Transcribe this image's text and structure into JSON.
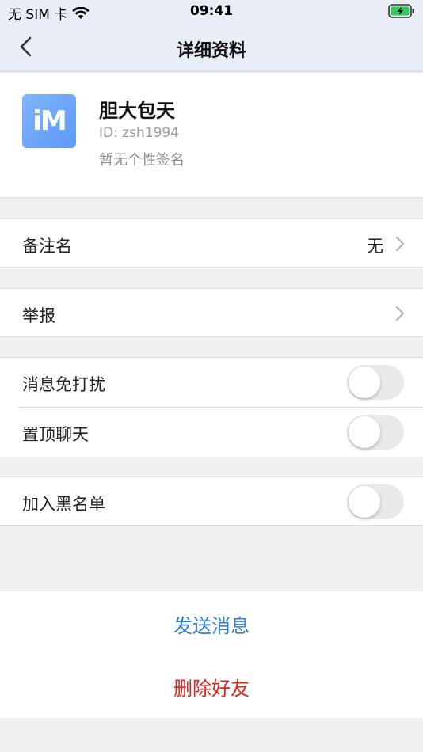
{
  "status_bar": {
    "carrier": "无 SIM 卡",
    "time": "09:41"
  },
  "nav": {
    "title": "详细资料"
  },
  "profile": {
    "avatar_text": "iM",
    "name": "胆大包天",
    "id": "ID: zsh1994",
    "signature": "暂无个性签名"
  },
  "settings": {
    "remark": {
      "label": "备注名",
      "value": "无"
    },
    "report": {
      "label": "举报"
    },
    "mute": {
      "label": "消息免打扰",
      "on": false
    },
    "pin": {
      "label": "置顶聊天",
      "on": false
    },
    "blacklist": {
      "label": "加入黑名单",
      "on": false
    }
  },
  "actions": {
    "send": "发送消息",
    "delete": "删除好友"
  },
  "colors": {
    "accent": "#2f7fd8",
    "danger": "#e0231c",
    "nav_bg": "#e9eef6"
  }
}
